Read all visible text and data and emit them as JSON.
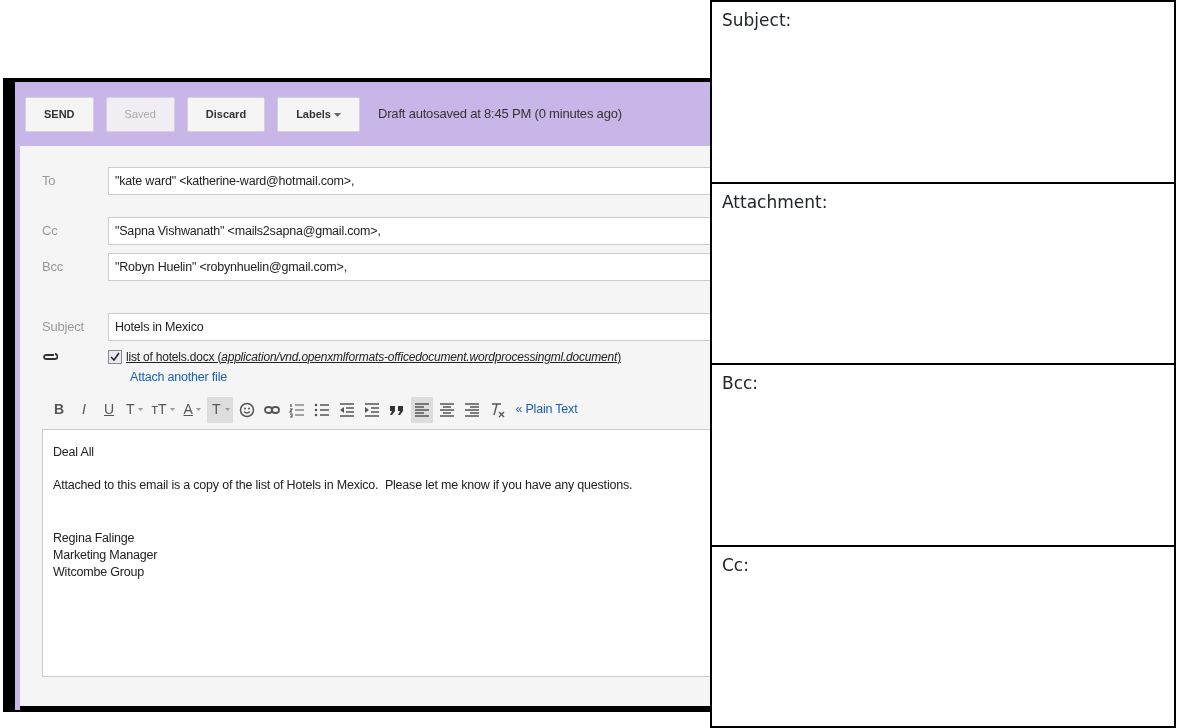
{
  "compose": {
    "buttons": [
      {
        "label": "SEND",
        "disabled": false
      },
      {
        "label": "Saved",
        "disabled": true
      },
      {
        "label": "Discard",
        "disabled": false
      },
      {
        "label": "Labels",
        "disabled": false,
        "dropdown": true
      }
    ],
    "status": "Draft autosaved at 8:45 PM (0 minutes ago)",
    "fields": [
      {
        "label": "To",
        "value": "\"kate ward\" <katherine-ward@hotmail.com>,"
      },
      {
        "label": "Cc",
        "value": "\"Sapna Vishwanath\" <mails2sapna@gmail.com>,"
      },
      {
        "label": "Bcc",
        "value": "\"Robyn Huelin\" <robynhuelin@gmail.com>,"
      },
      {
        "label": "Subject",
        "value": "Hotels in Mexico"
      }
    ],
    "attachment": {
      "checked": true,
      "text": "list of hotels.docx (*application/vnd.openxmlformats-officedocument.wordprocessingml.document*)",
      "link": "Attach another file"
    },
    "toolbar": [
      {
        "kind": "glyph",
        "text": "B",
        "selected": false,
        "dropdown": false
      },
      {
        "kind": "glyph",
        "text": "I",
        "selected": false,
        "dropdown": false
      },
      {
        "kind": "glyph",
        "text": "U",
        "selected": false,
        "dropdown": false
      },
      {
        "kind": "glyph",
        "text": "T",
        "selected": false,
        "dropdown": true
      },
      {
        "kind": "glyph",
        "text": "ᴛT",
        "selected": false,
        "dropdown": true
      },
      {
        "kind": "glyph",
        "text": "A",
        "selected": false,
        "dropdown": true
      },
      {
        "kind": "glyph",
        "text": "T",
        "selected": true,
        "dropdown": true
      },
      {
        "kind": "smiley",
        "selected": false,
        "dropdown": false
      },
      {
        "kind": "link",
        "selected": false,
        "dropdown": false
      },
      {
        "kind": "numbered-list",
        "selected": false,
        "dropdown": false
      },
      {
        "kind": "bullet-list",
        "selected": false,
        "dropdown": false
      },
      {
        "kind": "outdent",
        "selected": false,
        "dropdown": false
      },
      {
        "kind": "indent",
        "selected": false,
        "dropdown": false
      },
      {
        "kind": "quote",
        "selected": false,
        "dropdown": false
      },
      {
        "kind": "align-left",
        "selected": true,
        "dropdown": false
      },
      {
        "kind": "align-center",
        "selected": false,
        "dropdown": false
      },
      {
        "kind": "align-right",
        "selected": false,
        "dropdown": false
      },
      {
        "kind": "clear-format",
        "selected": false,
        "dropdown": false
      }
    ],
    "plain_text_link": "« Plain Text",
    "body": [
      {
        "lines": [
          "Deal All"
        ]
      },
      {
        "lines": [
          "Attached to this email is a copy of the list of Hotels in Mexico.  Please let me know if you have any questions."
        ]
      },
      {
        "lines": [
          "Regina Falinge",
          "Marketing Manager",
          "Witcombe Group"
        ]
      }
    ]
  },
  "worksheet": [
    {
      "label": "Subject:"
    },
    {
      "label": "Attachment:"
    },
    {
      "label": "Bcc:"
    },
    {
      "label": "Cc:"
    }
  ]
}
